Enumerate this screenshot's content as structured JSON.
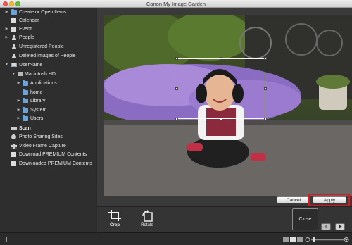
{
  "window": {
    "title": "Canon My Image Garden"
  },
  "sidebar": {
    "items": [
      {
        "label": "Create or Open Items",
        "icon": "folder-icon",
        "expanded": false
      },
      {
        "label": "Calendar",
        "icon": "calendar-icon"
      },
      {
        "label": "Event",
        "icon": "event-icon",
        "expanded": false
      },
      {
        "label": "People",
        "icon": "person-icon",
        "expanded": false
      },
      {
        "label": "Unregistered People",
        "icon": "person-icon"
      },
      {
        "label": "Deleted Images of People",
        "icon": "person-icon"
      },
      {
        "label": "UserName",
        "icon": "monitor-icon",
        "expanded": true
      },
      {
        "label": "Macintosh HD",
        "icon": "disk-icon",
        "expanded": true
      },
      {
        "label": "Applications",
        "icon": "folder-icon",
        "expanded": false
      },
      {
        "label": "home",
        "icon": "folder-icon"
      },
      {
        "label": "Library",
        "icon": "folder-icon",
        "expanded": false
      },
      {
        "label": "System",
        "icon": "folder-icon",
        "expanded": false
      },
      {
        "label": "Users",
        "icon": "folder-icon",
        "expanded": false
      },
      {
        "label": "Scan",
        "icon": "scanner-icon"
      },
      {
        "label": "Photo Sharing Sites",
        "icon": "globe-icon"
      },
      {
        "label": "Video Frame Capture",
        "icon": "film-icon"
      },
      {
        "label": "Download PREMIUM Contents",
        "icon": "download-icon"
      },
      {
        "label": "Downloaded PREMIUM Contents",
        "icon": "folder-icon"
      }
    ]
  },
  "editor": {
    "cancel_label": "Cancel",
    "apply_label": "Apply",
    "tools": [
      {
        "label": "Crop",
        "icon": "crop-icon"
      },
      {
        "label": "Rotate",
        "icon": "rotate-icon"
      }
    ],
    "close_label": "Close"
  },
  "colors": {
    "highlight": "#e0141c",
    "accent": "#6ea3d8"
  }
}
